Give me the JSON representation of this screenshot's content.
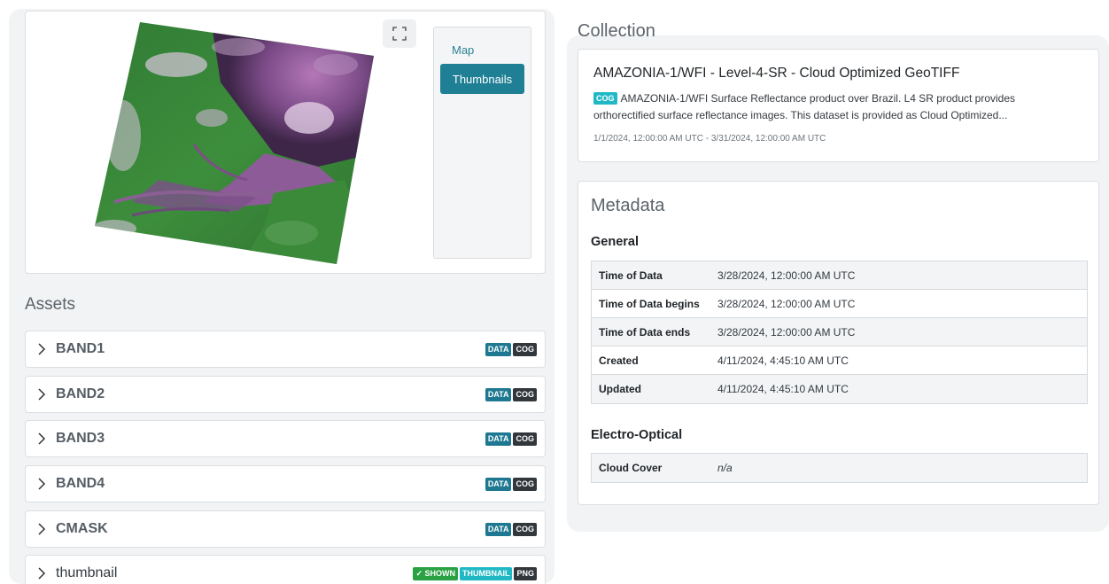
{
  "viewer": {
    "tabs": {
      "map": "Map",
      "thumbnails": "Thumbnails"
    }
  },
  "assets": {
    "title": "Assets",
    "items": [
      {
        "name": "BAND1",
        "badges": [
          "DATA",
          "COG"
        ]
      },
      {
        "name": "BAND2",
        "badges": [
          "DATA",
          "COG"
        ]
      },
      {
        "name": "BAND3",
        "badges": [
          "DATA",
          "COG"
        ]
      },
      {
        "name": "BAND4",
        "badges": [
          "DATA",
          "COG"
        ]
      },
      {
        "name": "CMASK",
        "badges": [
          "DATA",
          "COG"
        ]
      },
      {
        "name": "thumbnail",
        "badges": [
          "✓ SHOWN",
          "THUMBNAIL",
          "PNG"
        ]
      }
    ]
  },
  "collection": {
    "heading": "Collection",
    "name": "AMAZONIA-1/WFI - Level-4-SR - Cloud Optimized GeoTIFF",
    "badge": "COG",
    "description": "AMAZONIA-1/WFI Surface Reflectance product over Brazil. L4 SR product provides orthorectified surface reflectance images. This dataset is provided as Cloud Optimized...",
    "date_range": "1/1/2024, 12:00:00 AM UTC - 3/31/2024, 12:00:00 AM UTC"
  },
  "metadata": {
    "heading": "Metadata",
    "general": {
      "title": "General",
      "rows": [
        {
          "key": "Time of Data",
          "value": "3/28/2024, 12:00:00 AM UTC"
        },
        {
          "key": "Time of Data begins",
          "value": "3/28/2024, 12:00:00 AM UTC"
        },
        {
          "key": "Time of Data ends",
          "value": "3/28/2024, 12:00:00 AM UTC"
        },
        {
          "key": "Created",
          "value": "4/11/2024, 4:45:10 AM UTC"
        },
        {
          "key": "Updated",
          "value": "4/11/2024, 4:45:10 AM UTC"
        }
      ]
    },
    "eo": {
      "title": "Electro-Optical",
      "rows": [
        {
          "key": "Cloud Cover",
          "value": "n/a"
        }
      ]
    }
  },
  "colors": {
    "accent": "#1f7f94",
    "data_badge": "#1e7891",
    "dark_badge": "#32373c",
    "shown_badge": "#2aa142",
    "thumbnail_badge": "#21b8c6"
  },
  "icons": {
    "fullscreen": "fullscreen-icon",
    "chevron": "chevron-right-icon",
    "check": "check-icon"
  }
}
